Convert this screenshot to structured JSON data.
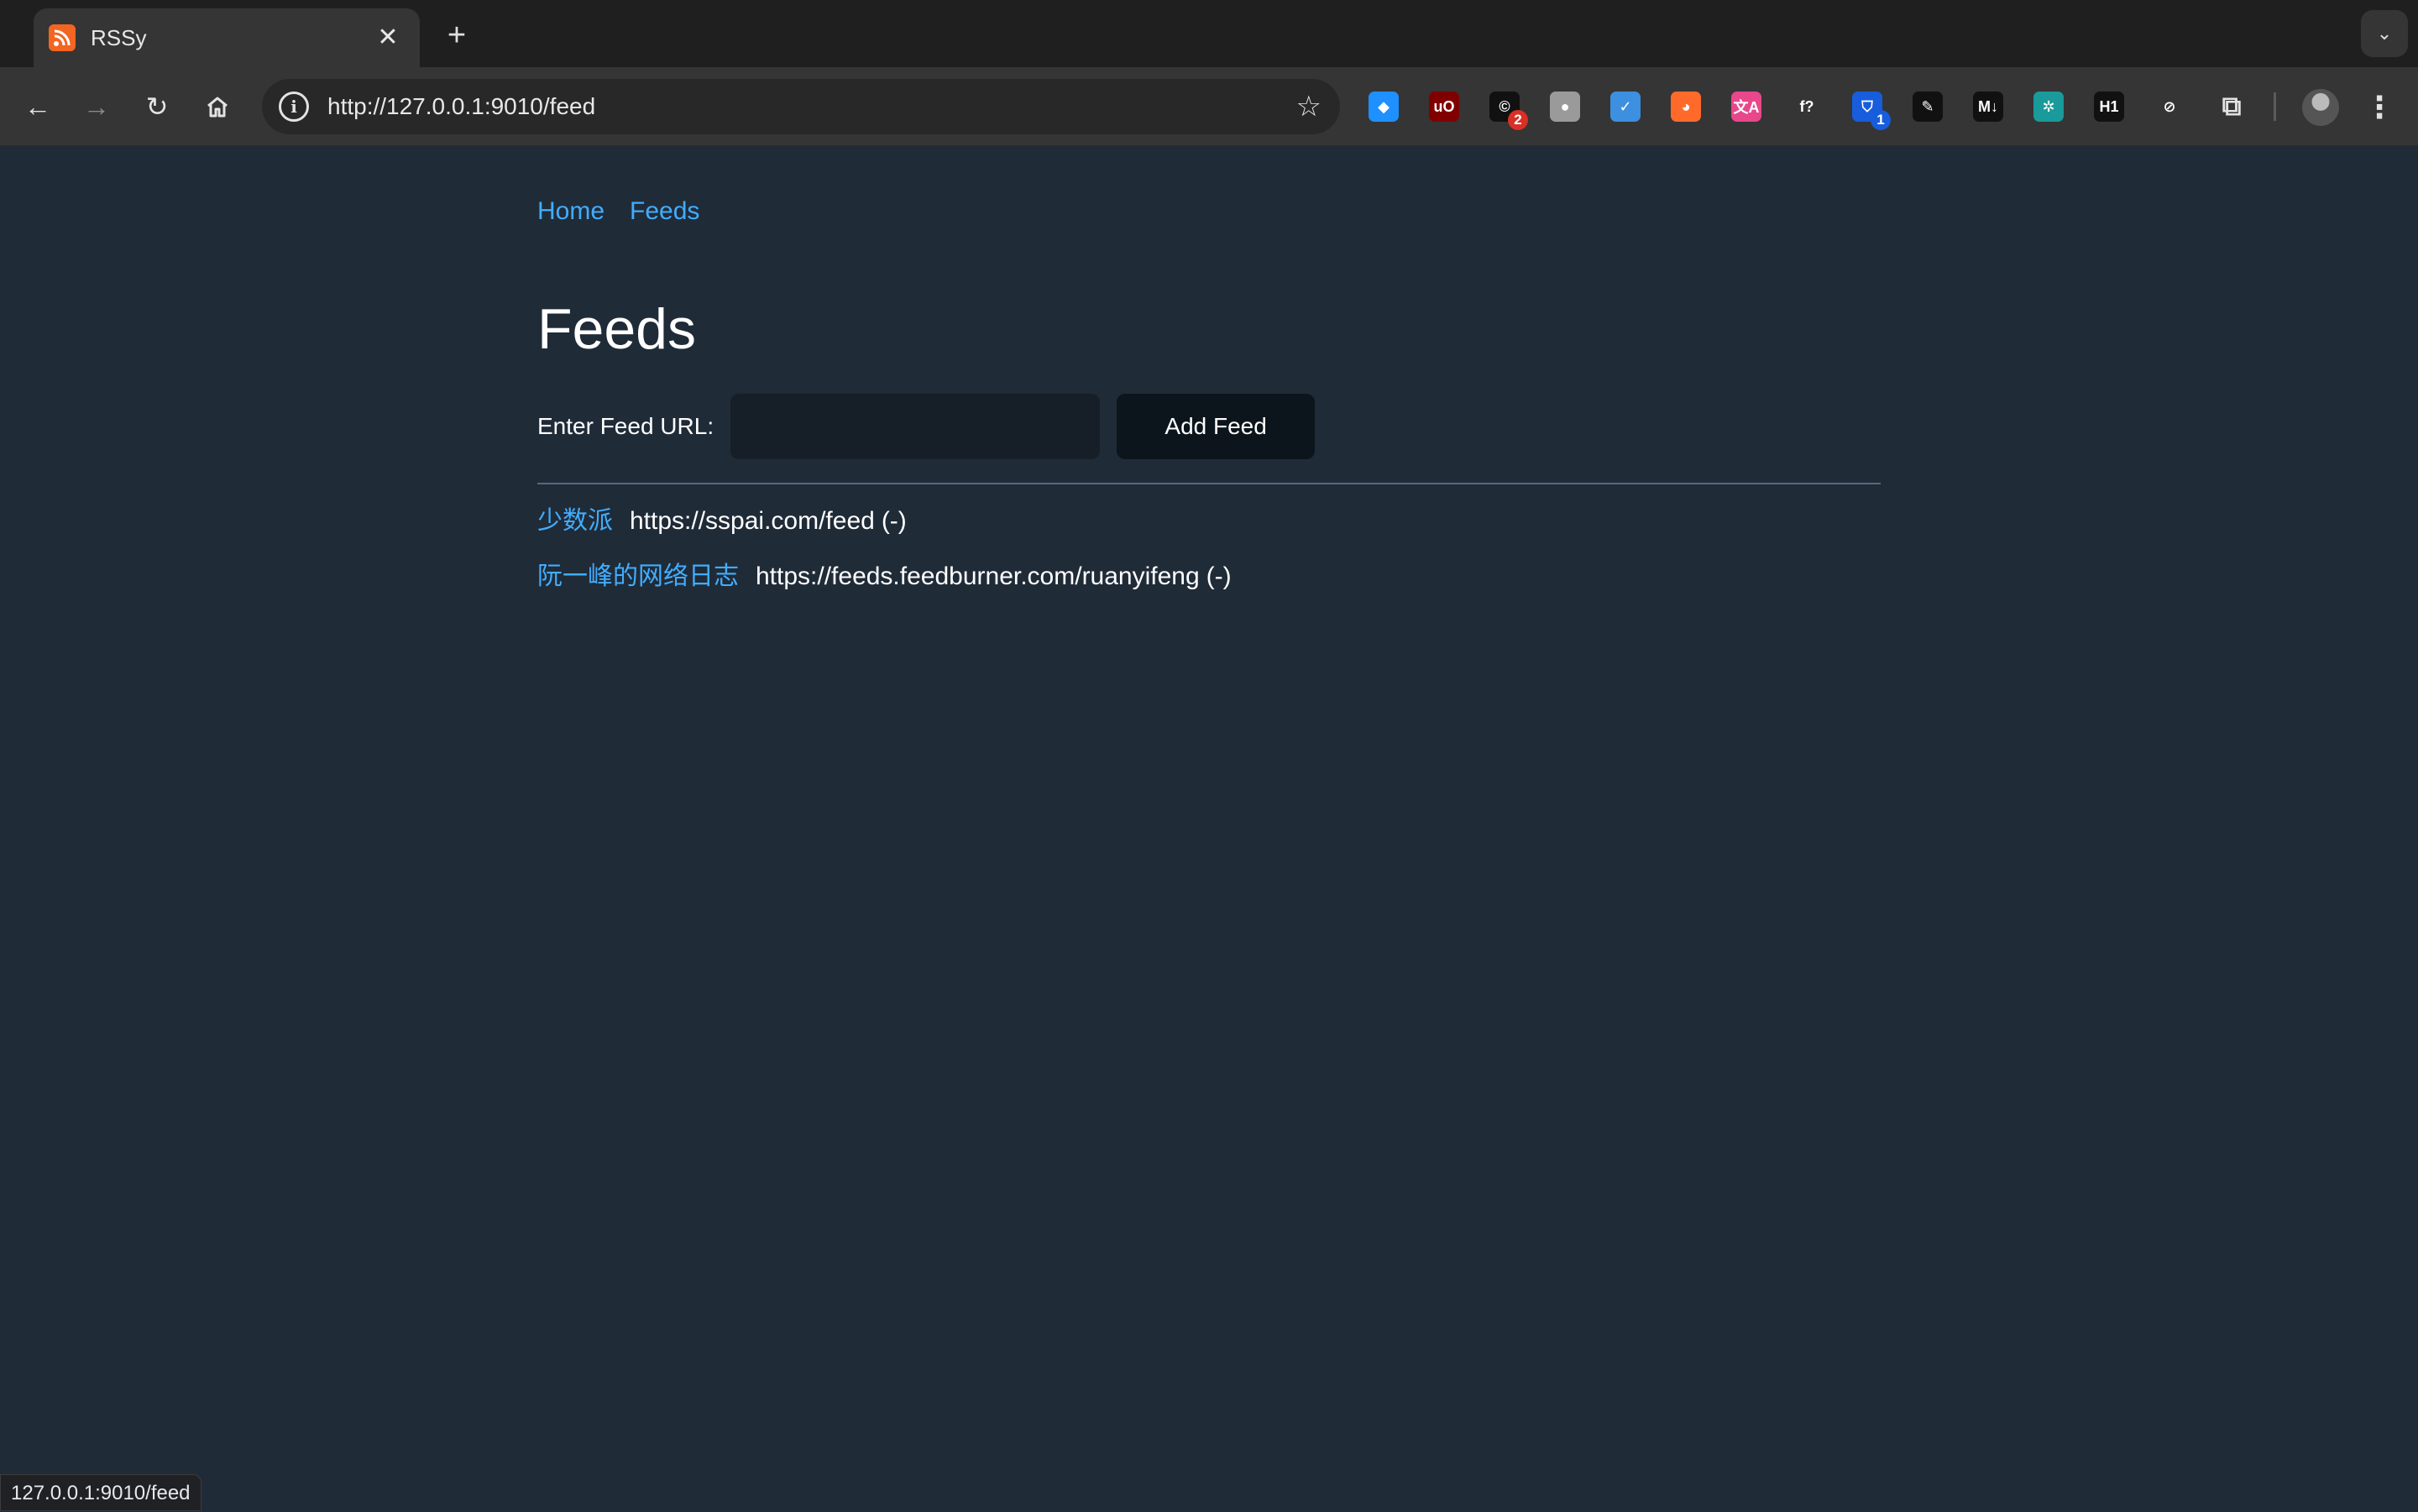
{
  "browser": {
    "tab_title": "RSSy",
    "close_symbol": "✕",
    "new_tab_symbol": "+",
    "url": "http://127.0.0.1:9010/feed",
    "status_url": "127.0.0.1:9010/feed",
    "extensions": [
      {
        "name": "diamond-extension-icon",
        "glyph": "◆",
        "color": "#1e90ff",
        "badge": ""
      },
      {
        "name": "ublock-extension-icon",
        "glyph": "uO",
        "color": "#800000",
        "badge": ""
      },
      {
        "name": "capture-extension-icon",
        "glyph": "©",
        "color": "#111111",
        "badge": "2"
      },
      {
        "name": "circle-extension-icon",
        "glyph": "●",
        "color": "#9a9a9a",
        "badge": ""
      },
      {
        "name": "check-extension-icon",
        "glyph": "✓",
        "color": "#3d8fe0",
        "badge": ""
      },
      {
        "name": "orange-extension-icon",
        "glyph": "◕",
        "color": "#ff6a2b",
        "badge": ""
      },
      {
        "name": "translate-extension-icon",
        "glyph": "文A",
        "color": "#e8478b",
        "badge": ""
      },
      {
        "name": "font-extension-icon",
        "glyph": "f?",
        "color": "#353535",
        "badge": ""
      },
      {
        "name": "bitwarden-extension-icon",
        "glyph": "⛉",
        "color": "#175ddc",
        "badge": "1"
      },
      {
        "name": "edit-extension-icon",
        "glyph": "✎",
        "color": "#111111",
        "badge": ""
      },
      {
        "name": "markdown-extension-icon",
        "glyph": "M↓",
        "color": "#111111",
        "badge": ""
      },
      {
        "name": "pattern-extension-icon",
        "glyph": "✲",
        "color": "#1a9a9a",
        "badge": ""
      },
      {
        "name": "heading-extension-icon",
        "glyph": "H1",
        "color": "#111111",
        "badge": ""
      },
      {
        "name": "compass-extension-icon",
        "glyph": "⊘",
        "color": "#353535",
        "badge": ""
      }
    ]
  },
  "nav": {
    "home": "Home",
    "feeds": "Feeds"
  },
  "page": {
    "heading": "Feeds",
    "form_label": "Enter Feed URL:",
    "input_value": "",
    "add_button": "Add Feed"
  },
  "feeds": [
    {
      "name": "少数派",
      "url": "https://sspai.com/feed",
      "remove": "(-)"
    },
    {
      "name": "阮一峰的网络日志",
      "url": "https://feeds.feedburner.com/ruanyifeng",
      "remove": "(-)"
    }
  ]
}
